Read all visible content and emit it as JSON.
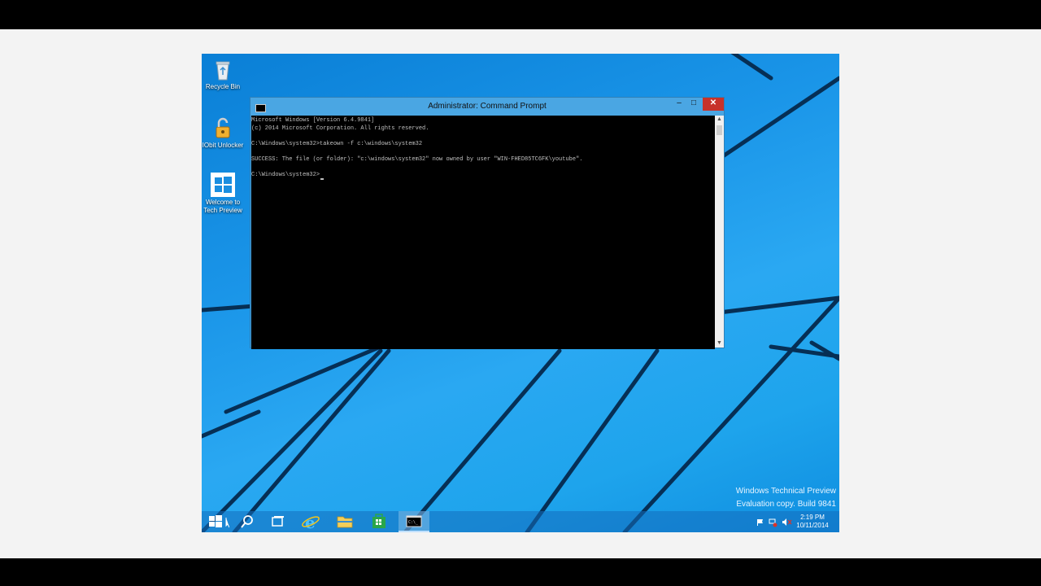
{
  "desktop": {
    "icons": [
      {
        "label": "Recycle Bin",
        "icon": "recycle-bin-icon"
      },
      {
        "label": "IObit Unlocker",
        "icon": "iobit-unlocker-icon"
      },
      {
        "label": "Welcome to Tech Preview",
        "icon": "windows-logo-icon"
      }
    ]
  },
  "cmd_window": {
    "title": "Administrator: Command Prompt",
    "minimize_label": "–",
    "maximize_label": "□",
    "close_label": "✕",
    "lines": [
      "Microsoft Windows [Version 6.4.9841]",
      "(c) 2014 Microsoft Corporation. All rights reserved.",
      "",
      "C:\\Windows\\system32>takeown -f c:\\windows\\system32",
      "",
      "SUCCESS: The file (or folder): \"c:\\windows\\system32\" now owned by user \"WIN-FHED85TC6FK\\youtube\".",
      "",
      "C:\\Windows\\system32>"
    ],
    "scroll_up": "▲",
    "scroll_down": "▼"
  },
  "watermark": {
    "line1": "Windows Technical Preview",
    "line2": "Evaluation copy. Build 9841"
  },
  "taskbar": {
    "buttons": [
      {
        "name": "start-button",
        "icon": "windows-logo-icon"
      },
      {
        "name": "search-button",
        "icon": "search-icon"
      },
      {
        "name": "task-view-button",
        "icon": "task-view-icon"
      },
      {
        "name": "internet-explorer-button",
        "icon": "internet-explorer-icon"
      },
      {
        "name": "file-explorer-button",
        "icon": "folder-icon"
      },
      {
        "name": "store-button",
        "icon": "store-icon"
      },
      {
        "name": "command-prompt-button",
        "icon": "command-prompt-icon"
      }
    ],
    "clock": {
      "time": "2:19 PM",
      "date": "10/11/2014"
    },
    "tray_icons": [
      "action-center-flag-icon",
      "network-icon",
      "volume-muted-icon"
    ]
  }
}
